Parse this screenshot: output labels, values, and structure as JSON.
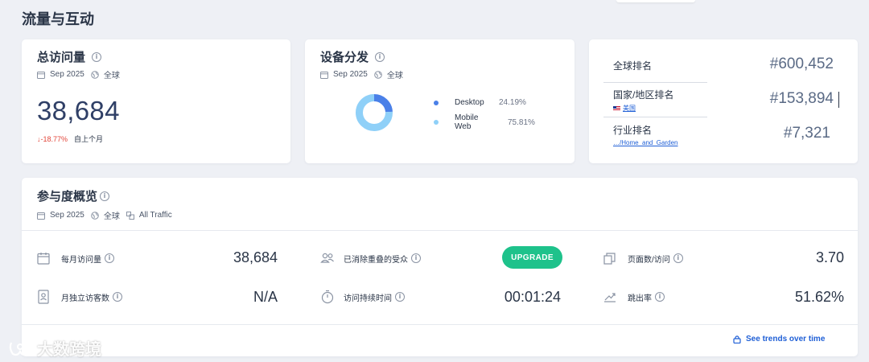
{
  "section_title": "流量与互动",
  "total_visits": {
    "title": "总访问量",
    "date": "Sep 2025",
    "region": "全球",
    "value": "38,684",
    "change": "-18.77%",
    "change_label": "自上个月"
  },
  "device": {
    "title": "设备分发",
    "date": "Sep 2025",
    "region": "全球",
    "items": [
      {
        "name": "Desktop",
        "value": "24.19%",
        "percent": 24.19,
        "color": "#4a80e8"
      },
      {
        "name": "Mobile Web",
        "value": "75.81%",
        "percent": 75.81,
        "color": "#8fd0f8"
      }
    ]
  },
  "ranks": {
    "global": {
      "label": "全球排名",
      "value": "#600,452"
    },
    "country": {
      "label": "国家/地区排名",
      "sub": "美国",
      "value": "#153,894"
    },
    "industry": {
      "label": "行业排名",
      "sub": "…/Home_and_Garden",
      "value": "#7,321"
    }
  },
  "engagement": {
    "title": "参与度概览",
    "date": "Sep 2025",
    "region": "全球",
    "traffic": "All Traffic",
    "metrics": {
      "monthly_visits": {
        "label": "每月访问量",
        "value": "38,684"
      },
      "unique_visitors": {
        "label": "月独立访客数",
        "value": "N/A"
      },
      "dedup_audience": {
        "label": "已消除重叠的受众"
      },
      "visit_duration": {
        "label": "访问持续时间",
        "value": "00:01:24"
      },
      "pages_per_visit": {
        "label": "页面数/访问",
        "value": "3.70"
      },
      "bounce_rate": {
        "label": "跳出率",
        "value": "51.62%"
      }
    },
    "upgrade_label": "UPGRADE",
    "trends_label": "See trends over time"
  },
  "watermark": "大数跨境",
  "colors": {
    "accent": "#1ec28b",
    "link": "#1f5fd6",
    "negative": "#e2463a"
  }
}
